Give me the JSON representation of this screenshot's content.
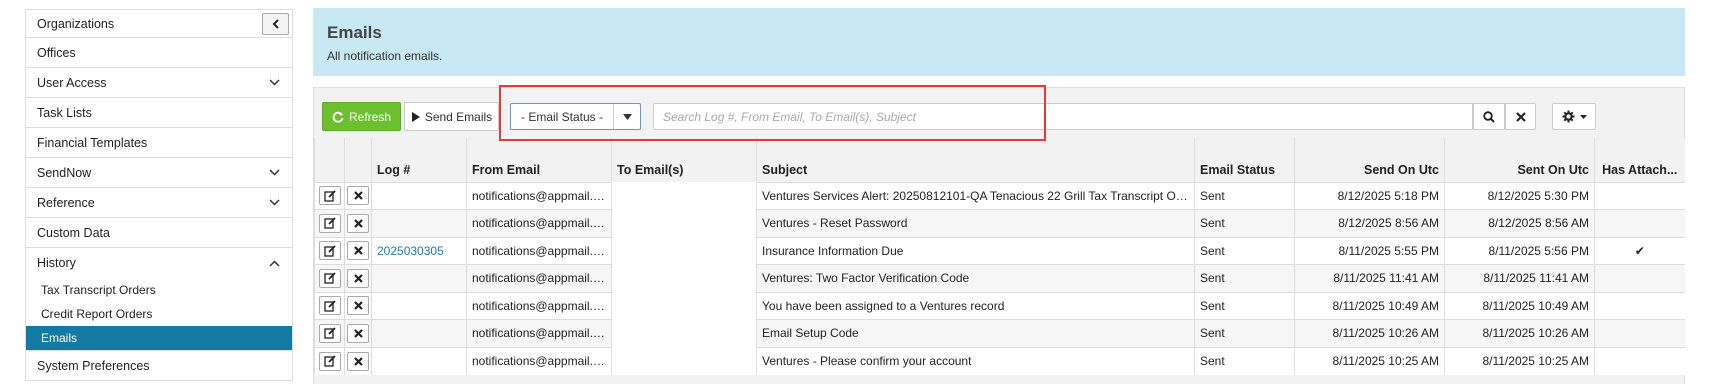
{
  "sidebar": {
    "items": [
      {
        "label": "Organizations"
      },
      {
        "label": "Offices"
      },
      {
        "label": "User Access"
      },
      {
        "label": "Task Lists"
      },
      {
        "label": "Financial Templates"
      },
      {
        "label": "SendNow"
      },
      {
        "label": "Reference"
      },
      {
        "label": "Custom Data"
      },
      {
        "label": "History"
      },
      {
        "label": "System Preferences"
      }
    ],
    "history_children": [
      {
        "label": "Tax Transcript Orders"
      },
      {
        "label": "Credit Report Orders"
      },
      {
        "label": "Emails"
      }
    ]
  },
  "header": {
    "title": "Emails",
    "subtitle": "All notification emails."
  },
  "toolbar": {
    "refresh_label": "Refresh",
    "send_label": "Send Emails",
    "status_select": "- Email Status -",
    "search_placeholder": "Search Log #, From Email, To Email(s), Subject"
  },
  "table": {
    "columns": {
      "log": "Log #",
      "from": "From Email",
      "to": "To Email(s)",
      "subject": "Subject",
      "status": "Email Status",
      "send_on": "Send On Utc",
      "sent_on": "Sent On Utc",
      "has_attach": "Has Attach..."
    },
    "rows": [
      {
        "log": "",
        "from": "notifications@appmail.ve...",
        "subject": "Ventures Services Alert: 20250812101-QA Tenacious 22 Grill Tax Transcript Or...",
        "status": "Sent",
        "send_on": "8/12/2025 5:18 PM",
        "sent_on": "8/12/2025 5:30 PM",
        "attach": ""
      },
      {
        "log": "",
        "from": "notifications@appmail.ve...",
        "subject": "Ventures - Reset Password",
        "status": "Sent",
        "send_on": "8/12/2025 8:56 AM",
        "sent_on": "8/12/2025 8:56 AM",
        "attach": ""
      },
      {
        "log": "2025030305",
        "from": "notifications@appmail.ve...",
        "subject": "Insurance Information Due",
        "status": "Sent",
        "send_on": "8/11/2025 5:55 PM",
        "sent_on": "8/11/2025 5:56 PM",
        "attach": "✔"
      },
      {
        "log": "",
        "from": "notifications@appmail.ve...",
        "subject": "Ventures: Two Factor Verification Code",
        "status": "Sent",
        "send_on": "8/11/2025 11:41 AM",
        "sent_on": "8/11/2025 11:41 AM",
        "attach": ""
      },
      {
        "log": "",
        "from": "notifications@appmail.ve...",
        "subject": "You have been assigned to a Ventures record",
        "status": "Sent",
        "send_on": "8/11/2025 10:49 AM",
        "sent_on": "8/11/2025 10:49 AM",
        "attach": ""
      },
      {
        "log": "",
        "from": "notifications@appmail.ve...",
        "subject": "Email Setup Code",
        "status": "Sent",
        "send_on": "8/11/2025 10:26 AM",
        "sent_on": "8/11/2025 10:26 AM",
        "attach": ""
      },
      {
        "log": "",
        "from": "notifications@appmail.ve...",
        "subject": "Ventures - Please confirm your account",
        "status": "Sent",
        "send_on": "8/11/2025 10:25 AM",
        "sent_on": "8/11/2025 10:25 AM",
        "attach": ""
      }
    ]
  },
  "icons": {
    "collapse": "chevron-left-icon",
    "expand": "chevron-down-icon",
    "collapse_group": "chevron-up-icon",
    "refresh": "refresh-icon",
    "send": "play-icon",
    "caret": "caret-down-icon",
    "search": "search-icon",
    "clear": "close-icon",
    "settings": "gear-icon",
    "edit": "edit-icon",
    "delete": "delete-icon",
    "attachment": "checkmark-icon"
  },
  "colors": {
    "header_bg": "#c8e9f3",
    "active_nav": "#127aa3",
    "refresh_btn": "#6cbf2e",
    "highlight": "#e33b3b",
    "link": "#1a7bb9"
  }
}
